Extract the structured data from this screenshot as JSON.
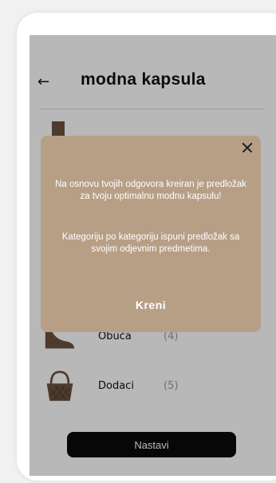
{
  "header": {
    "back_icon": "arrow-left-icon",
    "title": "modna kapsula"
  },
  "categories": [
    {
      "icon": "boot-icon",
      "label": "",
      "count": ""
    },
    {
      "icon": "shoe-icon",
      "label": "Obuća",
      "count": "(4)"
    },
    {
      "icon": "basket-bag-icon",
      "label": "Dodaci",
      "count": "(5)"
    }
  ],
  "footer": {
    "continue_label": "Nastavi"
  },
  "modal": {
    "close_icon": "close-icon",
    "message_1": "Na osnovu tvojih odgovora kreiran je predložak za tvoju optimalnu modnu kapsulu!",
    "message_2": "Kategoriju po kategoriju ispuni predložak sa svojim odjevnim predmetima.",
    "action_label": "Kreni"
  },
  "colors": {
    "modal_bg": "#b79f86",
    "button_bg": "#0b0b0b",
    "thumb": "#6b5342"
  }
}
